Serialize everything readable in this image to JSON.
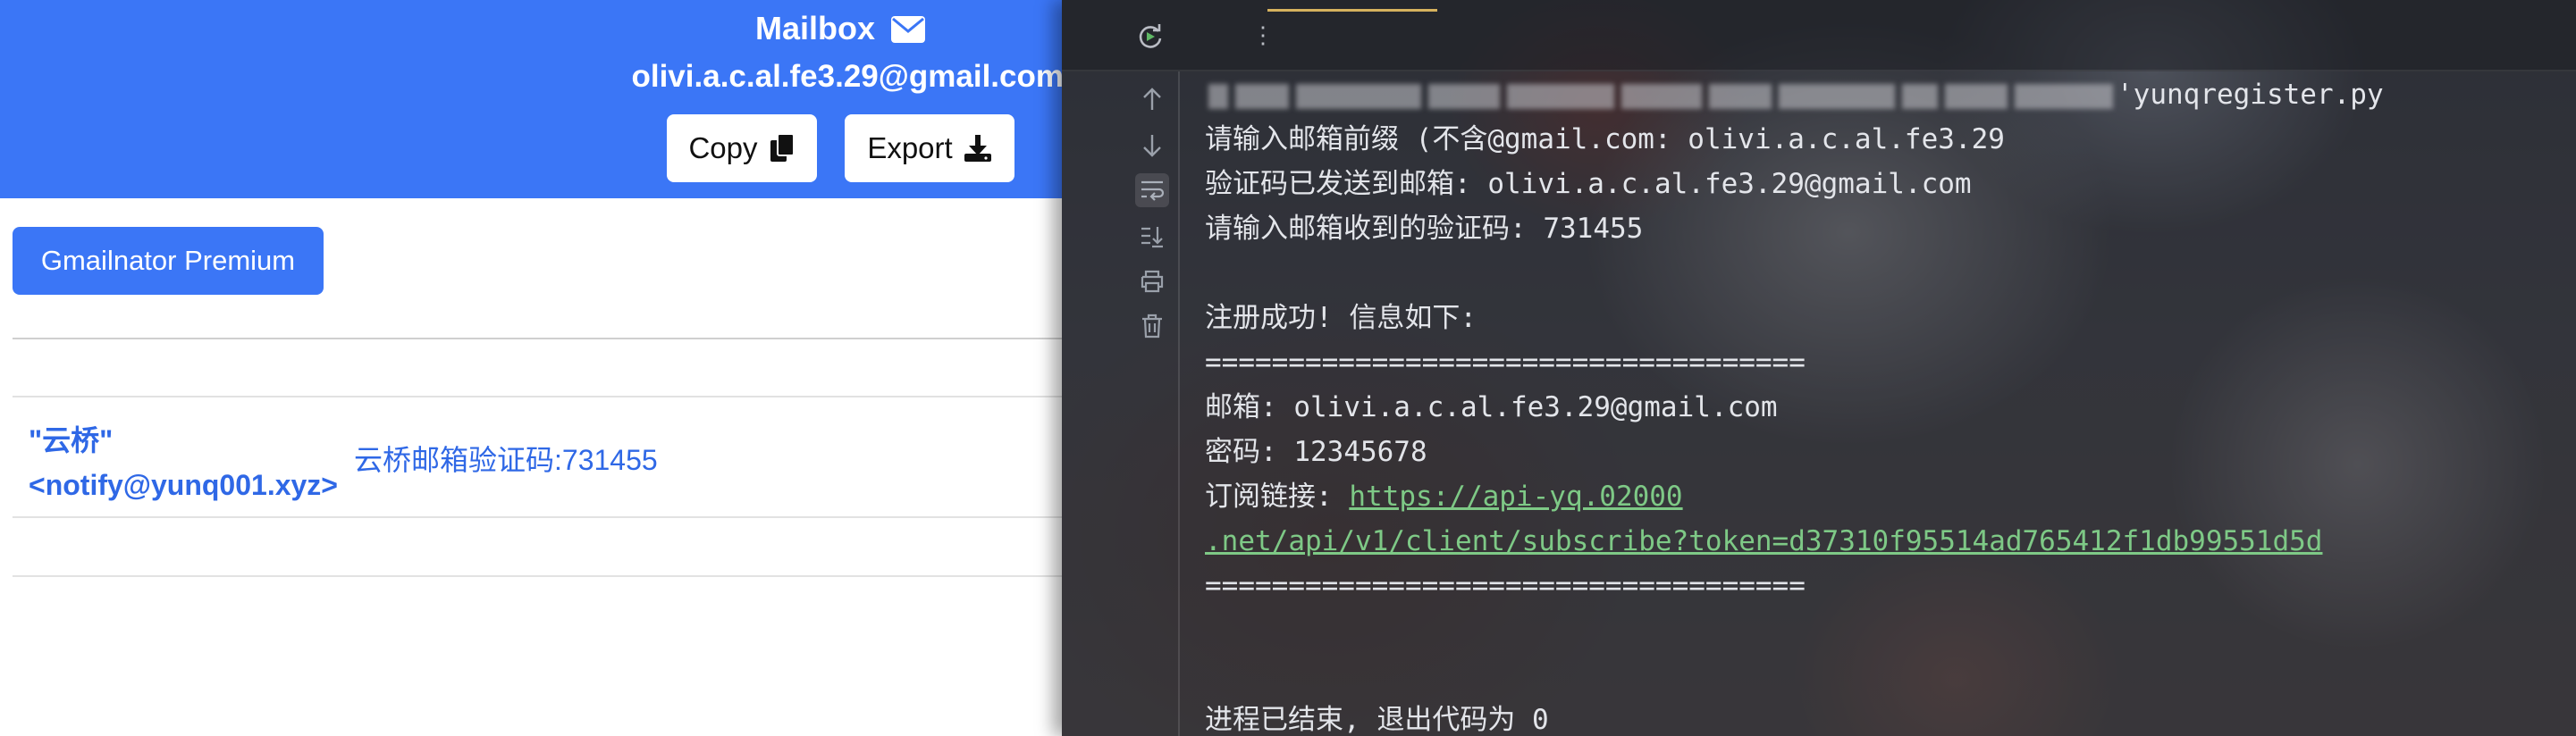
{
  "mailbox": {
    "title": "Mailbox",
    "address": "olivi.a.c.al.fe3.29@gmail.com",
    "copy_label": "Copy",
    "export_label": "Export",
    "premium_label": "Gmailnator Premium",
    "email": {
      "sender_name": "\"云桥\"",
      "sender_email": "<notify@yunq001.xyz>",
      "subject": "云桥邮箱验证码:731455"
    }
  },
  "ide": {
    "console": {
      "command_tail": "'yunqregister.py",
      "lines": [
        "请输入邮箱前缀 (不含@gmail.com: olivi.a.c.al.fe3.29",
        "验证码已发送到邮箱: olivi.a.c.al.fe3.29@gmail.com",
        "请输入邮箱收到的验证码: 731455",
        "注册成功! 信息如下:",
        "====================================",
        "邮箱: olivi.a.c.al.fe3.29@gmail.com",
        "密码: 12345678",
        "订阅链接: ",
        "====================================",
        "进程已结束, 退出代码为 0"
      ],
      "link_part1": "https://api-yq.02000",
      "link_part2": ".net/api/v1/client/subscribe?token=d37310f95514ad765412f1db99551d5d"
    }
  },
  "colors": {
    "header_blue": "#3b76f6",
    "link_green": "#7ec986",
    "mail_link_blue": "#2f68e6"
  },
  "icons": [
    "envelope-icon",
    "copy-icon",
    "download-icon",
    "rerun-icon",
    "more-icon",
    "scroll-up-icon",
    "scroll-down-icon",
    "soft-wrap-icon",
    "scroll-to-end-icon",
    "print-icon",
    "trash-icon"
  ]
}
